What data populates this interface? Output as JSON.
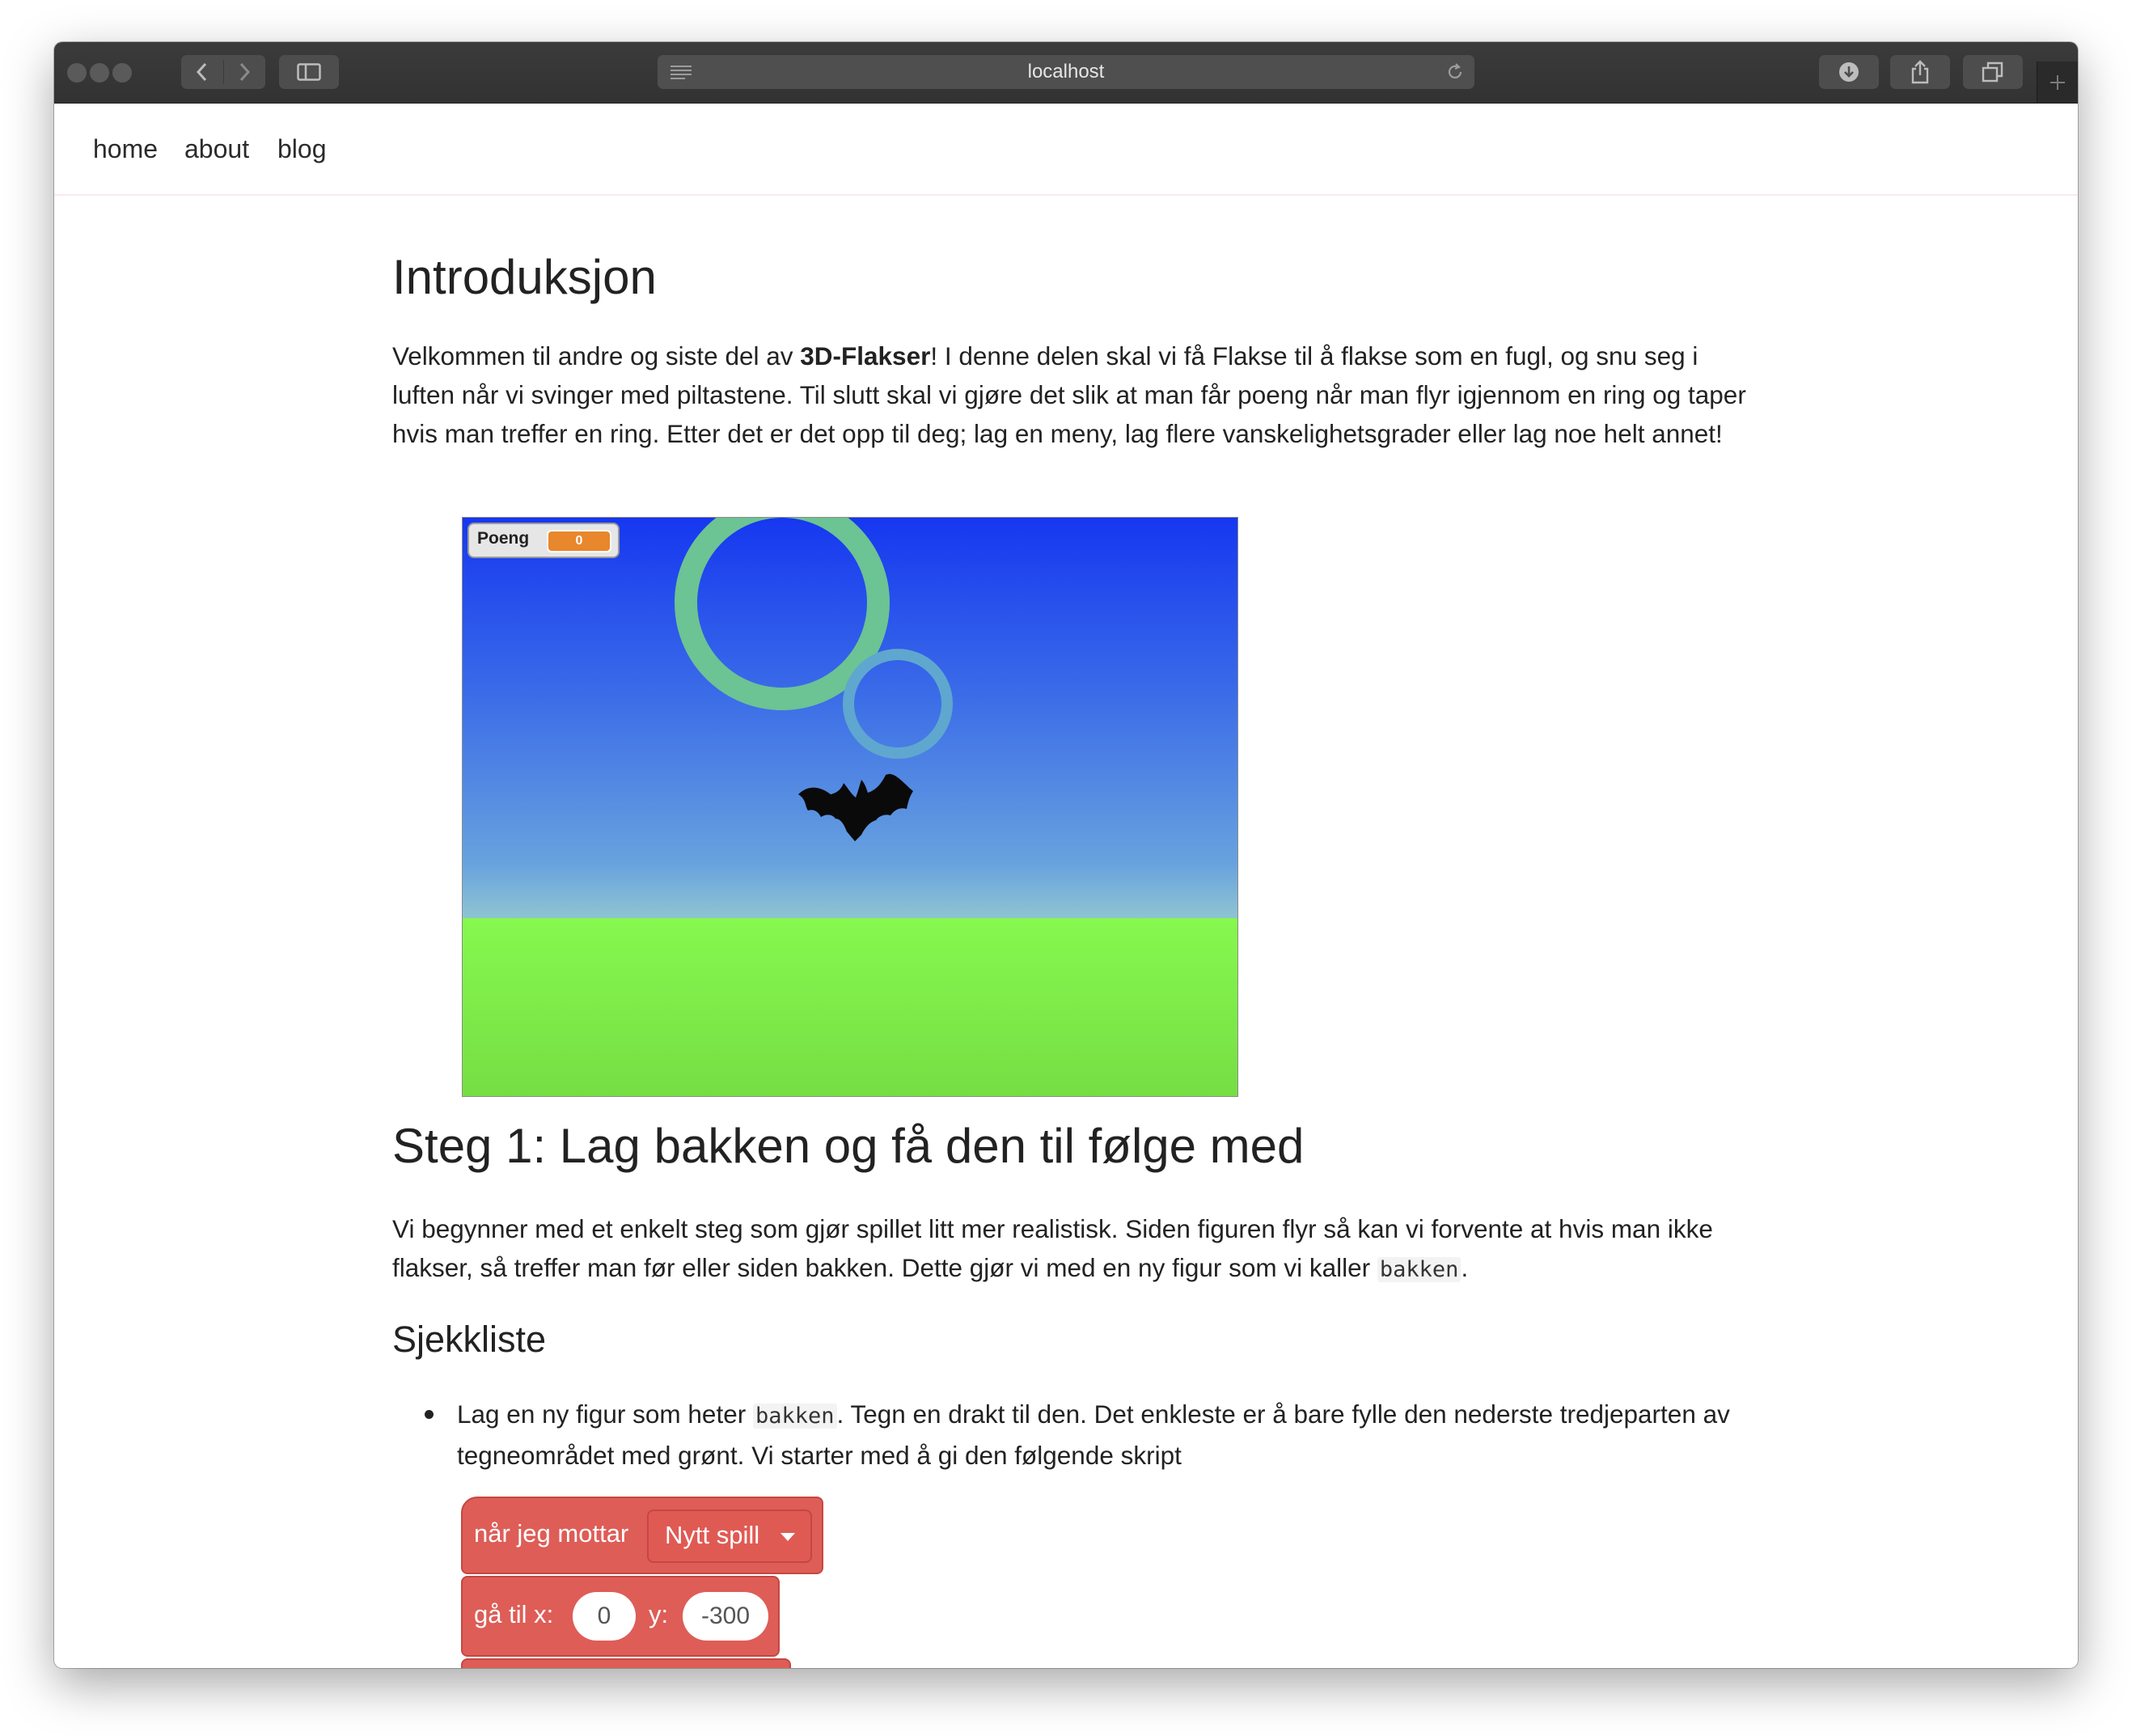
{
  "browser": {
    "url": "localhost"
  },
  "nav": {
    "links": [
      "home",
      "about",
      "blog"
    ]
  },
  "article": {
    "h1": "Introduksjon",
    "intro": {
      "before": "Velkommen til andre og siste del av ",
      "bold": "3D-Flakser",
      "after": "! I denne delen skal vi få Flakse til å flakse som en fugl, og snu seg i luften når vi svinger med piltastene. Til slutt skal vi gjøre det slik at man får poeng når man flyr igjennom en ring og taper hvis man treffer en ring. Etter det er det opp til deg; lag en meny, lag flere vanskelighetsgrader eller lag noe helt annet!"
    },
    "game": {
      "score_label": "Poeng",
      "score_value": "0",
      "sky_color": "#1637f0",
      "grass_color": "#86f84e",
      "ring_color": "#6cc394"
    },
    "h2": "Steg 1: Lag bakken og få den til følge med",
    "step1": {
      "before": "Vi begynner med et enkelt steg som gjør spillet litt mer realistisk. Siden figuren flyr så kan vi forvente at hvis man ikke flakser, så treffer man før eller siden bakken. Dette gjør vi med en ny figur som vi kaller ",
      "code": "bakken",
      "after": "."
    },
    "h3": "Sjekkliste",
    "checklist": {
      "before": "Lag en ny figur som heter ",
      "code": "bakken",
      "after": ". Tegn en drakt til den. Det enkleste er å bare fylle den nederste tredjeparten av tegneområdet med grønt. Vi starter med å gi den følgende skript"
    },
    "blocks": {
      "hat_label": "når jeg mottar",
      "hat_dropdown": "Nytt spill",
      "goto_label": "gå til x:",
      "goto_x": "0",
      "goto_y_label": "y:",
      "goto_y": "-300",
      "block_color": "#de5d57"
    }
  }
}
